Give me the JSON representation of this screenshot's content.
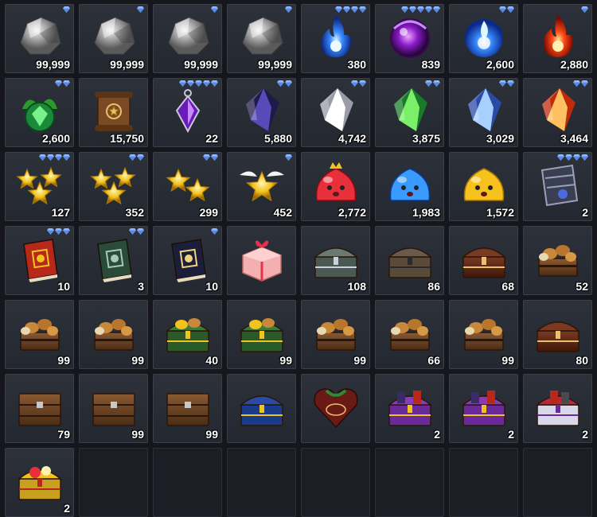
{
  "inventory": {
    "slots": [
      {
        "icon": "silver-ore-icon",
        "gems": 1,
        "count": "99,999"
      },
      {
        "icon": "silver-ore-icon",
        "gems": 1,
        "count": "99,999"
      },
      {
        "icon": "silver-ore-icon",
        "gems": 1,
        "count": "99,999"
      },
      {
        "icon": "silver-ore-icon",
        "gems": 1,
        "count": "99,999"
      },
      {
        "icon": "blue-flame-icon",
        "gems": 4,
        "count": "380"
      },
      {
        "icon": "purple-orb-icon",
        "gems": 5,
        "count": "839"
      },
      {
        "icon": "blue-spirit-icon",
        "gems": 2,
        "count": "2,600"
      },
      {
        "icon": "red-flame-icon",
        "gems": 1,
        "count": "2,880"
      },
      {
        "icon": "green-leaf-gem-icon",
        "gems": 2,
        "count": "2,600"
      },
      {
        "icon": "scroll-icon",
        "gems": 0,
        "count": "15,750"
      },
      {
        "icon": "purple-crystal-pendant-icon",
        "gems": 5,
        "count": "22"
      },
      {
        "icon": "dark-crystal-icon",
        "gems": 2,
        "count": "5,880"
      },
      {
        "icon": "white-crystal-icon",
        "gems": 2,
        "count": "4,742"
      },
      {
        "icon": "green-crystal-icon",
        "gems": 2,
        "count": "3,875"
      },
      {
        "icon": "blue-crystal-icon",
        "gems": 2,
        "count": "3,029"
      },
      {
        "icon": "orange-crystal-icon",
        "gems": 2,
        "count": "3,464"
      },
      {
        "icon": "triple-star-icon",
        "gems": 4,
        "count": "127"
      },
      {
        "icon": "triple-star-icon",
        "gems": 2,
        "count": "352"
      },
      {
        "icon": "double-star-icon",
        "gems": 2,
        "count": "299"
      },
      {
        "icon": "winged-star-icon",
        "gems": 1,
        "count": "452"
      },
      {
        "icon": "red-slime-icon",
        "gems": 0,
        "count": "2,772"
      },
      {
        "icon": "blue-slime-icon",
        "gems": 0,
        "count": "1,983"
      },
      {
        "icon": "yellow-slime-icon",
        "gems": 0,
        "count": "1,572"
      },
      {
        "icon": "armor-piece-icon",
        "gems": 4,
        "count": "2"
      },
      {
        "icon": "red-book-icon",
        "gems": 3,
        "count": "10"
      },
      {
        "icon": "green-book-icon",
        "gems": 2,
        "count": "3"
      },
      {
        "icon": "dark-book-icon",
        "gems": 1,
        "count": "10"
      },
      {
        "icon": "gift-box-icon",
        "gems": 0,
        "count": ""
      },
      {
        "icon": "silver-chest-icon",
        "gems": 0,
        "count": "108"
      },
      {
        "icon": "iron-chest-icon",
        "gems": 0,
        "count": "86"
      },
      {
        "icon": "wooden-chest-icon",
        "gems": 0,
        "count": "68"
      },
      {
        "icon": "food-chest-icon",
        "gems": 0,
        "count": "52"
      },
      {
        "icon": "food-chest-icon",
        "gems": 0,
        "count": "99"
      },
      {
        "icon": "food-chest-icon",
        "gems": 0,
        "count": "99"
      },
      {
        "icon": "green-treasure-chest-icon",
        "gems": 0,
        "count": "40"
      },
      {
        "icon": "green-treasure-chest-icon",
        "gems": 0,
        "count": "99"
      },
      {
        "icon": "food-chest-icon",
        "gems": 0,
        "count": "99"
      },
      {
        "icon": "food-chest-icon",
        "gems": 0,
        "count": "66"
      },
      {
        "icon": "food-chest-icon",
        "gems": 0,
        "count": "99"
      },
      {
        "icon": "wooden-chest-icon",
        "gems": 0,
        "count": "80"
      },
      {
        "icon": "wooden-crate-icon",
        "gems": 0,
        "count": "79"
      },
      {
        "icon": "wooden-crate-icon",
        "gems": 0,
        "count": "99"
      },
      {
        "icon": "wooden-crate-icon",
        "gems": 0,
        "count": "99"
      },
      {
        "icon": "blue-gold-chest-icon",
        "gems": 0,
        "count": ""
      },
      {
        "icon": "chocolate-heart-box-icon",
        "gems": 0,
        "count": ""
      },
      {
        "icon": "purple-gift-chest-icon",
        "gems": 0,
        "count": "2"
      },
      {
        "icon": "purple-gift-chest-icon",
        "gems": 0,
        "count": "2"
      },
      {
        "icon": "red-gift-chest-icon",
        "gems": 0,
        "count": "2"
      },
      {
        "icon": "golden-treasure-chest-icon",
        "gems": 0,
        "count": "2"
      },
      {
        "icon": "empty-slot",
        "gems": 0,
        "count": ""
      },
      {
        "icon": "empty-slot",
        "gems": 0,
        "count": ""
      },
      {
        "icon": "empty-slot",
        "gems": 0,
        "count": ""
      },
      {
        "icon": "empty-slot",
        "gems": 0,
        "count": ""
      },
      {
        "icon": "empty-slot",
        "gems": 0,
        "count": ""
      },
      {
        "icon": "empty-slot",
        "gems": 0,
        "count": ""
      },
      {
        "icon": "empty-slot",
        "gems": 0,
        "count": ""
      }
    ]
  },
  "colors": {
    "gem": "#8fb8ff",
    "count_text": "#ffffff",
    "slot_bg": "#2c313a",
    "empty_slot_bg": "#1b1e24"
  }
}
